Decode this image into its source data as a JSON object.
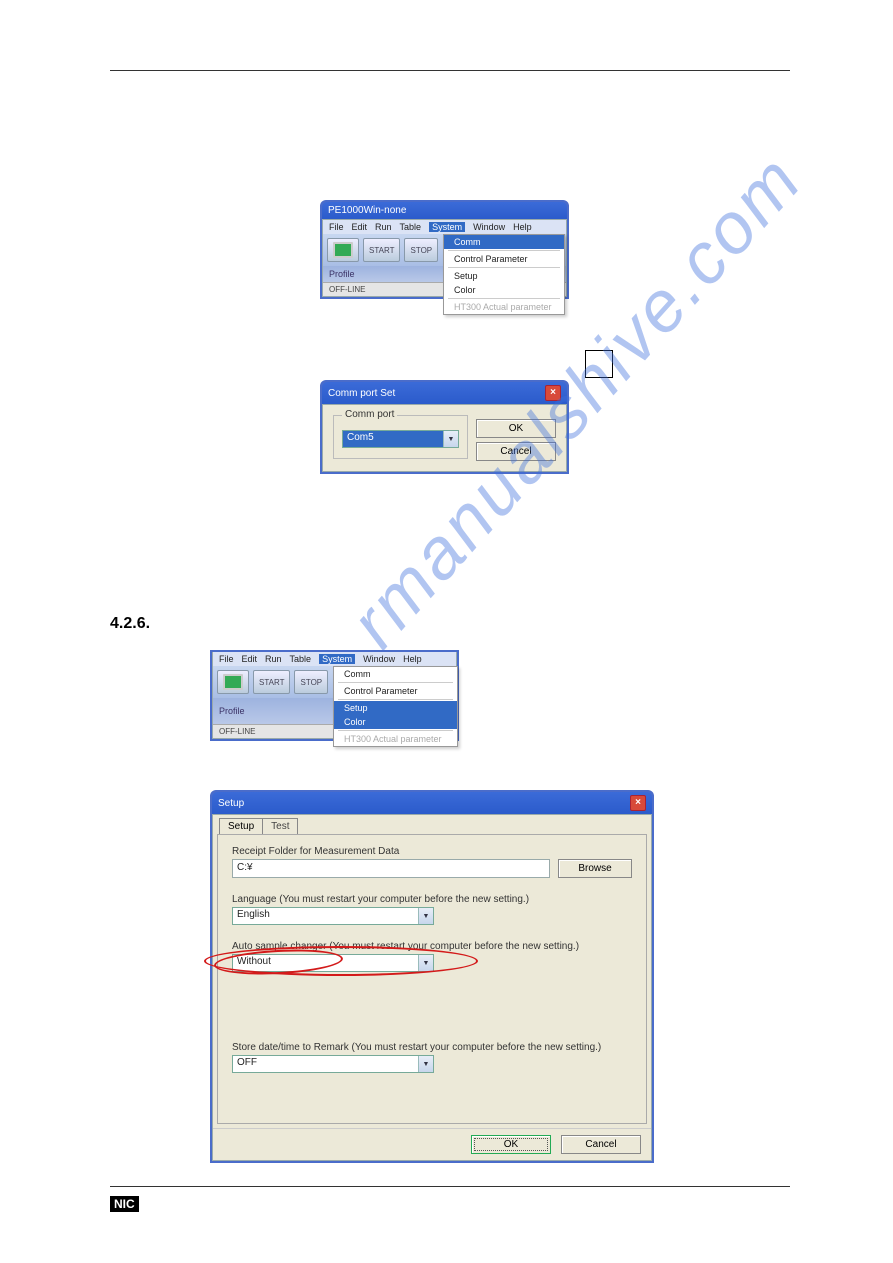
{
  "section_number": "4.2.6.",
  "watermark": "rmanualshive.com",
  "footer": {
    "badge": "NIC"
  },
  "window_a": {
    "title": "PE1000Win-none",
    "menu": [
      "File",
      "Edit",
      "Run",
      "Table",
      "System",
      "Window",
      "Help"
    ],
    "selected_menu": "System",
    "dropdown": {
      "highlighted": "Comm",
      "items": [
        "Comm",
        "Control Parameter",
        "Setup",
        "Color",
        "HT300 Actual parameter"
      ]
    },
    "toolbar": {
      "start": "START",
      "stop": "STOP"
    },
    "profile_label": "Profile",
    "offline": "OFF-LINE"
  },
  "dialog_comm": {
    "title": "Comm port Set",
    "group": "Comm port",
    "combo_value": "Com5",
    "ok": "OK",
    "cancel": "Cancel"
  },
  "window_b": {
    "menu": [
      "File",
      "Edit",
      "Run",
      "Table",
      "System",
      "Window",
      "Help"
    ],
    "selected_menu": "System",
    "dropdown": {
      "items": [
        "Comm",
        "Control Parameter",
        "Setup",
        "Color",
        "HT300 Actual parameter"
      ],
      "highlighted": "Setup"
    },
    "toolbar": {
      "start": "START",
      "stop": "STOP"
    },
    "profile_label": "Profile",
    "offline": "OFF-LINE"
  },
  "dialog_setup": {
    "title": "Setup",
    "tabs": [
      "Setup",
      "Test"
    ],
    "receipt_label": "Receipt Folder for Measurement Data",
    "receipt_value": "C:¥",
    "browse": "Browse",
    "language_label": "Language   (You must restart your computer before the new setting.)",
    "language_value": "English",
    "sampler_label": "Auto sample changer   (You must restart your computer before the new setting.)",
    "sampler_value": "Without",
    "store_label": "Store date/time to Remark   (You must restart your computer before the new setting.)",
    "store_value": "OFF",
    "ok": "OK",
    "cancel": "Cancel"
  }
}
